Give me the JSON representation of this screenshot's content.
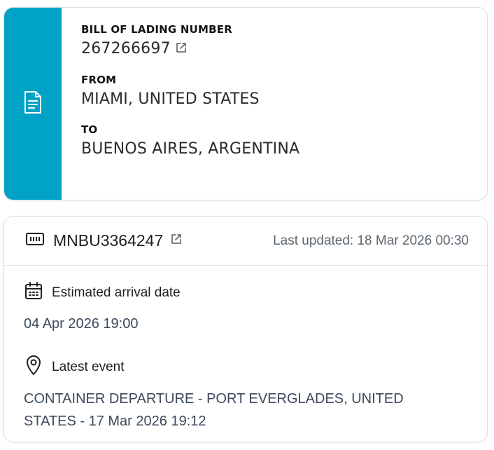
{
  "bill_of_lading": {
    "number_label": "BILL OF LADING NUMBER",
    "number": "267266697",
    "from_label": "FROM",
    "from": "MIAMI, UNITED STATES",
    "to_label": "TO",
    "to": "BUENOS AIRES, ARGENTINA",
    "accent_color": "#00a2c6",
    "icon": "document-icon"
  },
  "container": {
    "id": "MNBU3364247",
    "icon": "container-icon",
    "last_updated": "Last updated: 18 Mar 2026 00:30",
    "estimated_arrival_label": "Estimated arrival date",
    "estimated_arrival": "04 Apr 2026 19:00",
    "latest_event_label": "Latest event",
    "latest_event": "CONTAINER DEPARTURE - PORT EVERGLADES, UNITED STATES - 17 Mar 2026 19:12"
  }
}
